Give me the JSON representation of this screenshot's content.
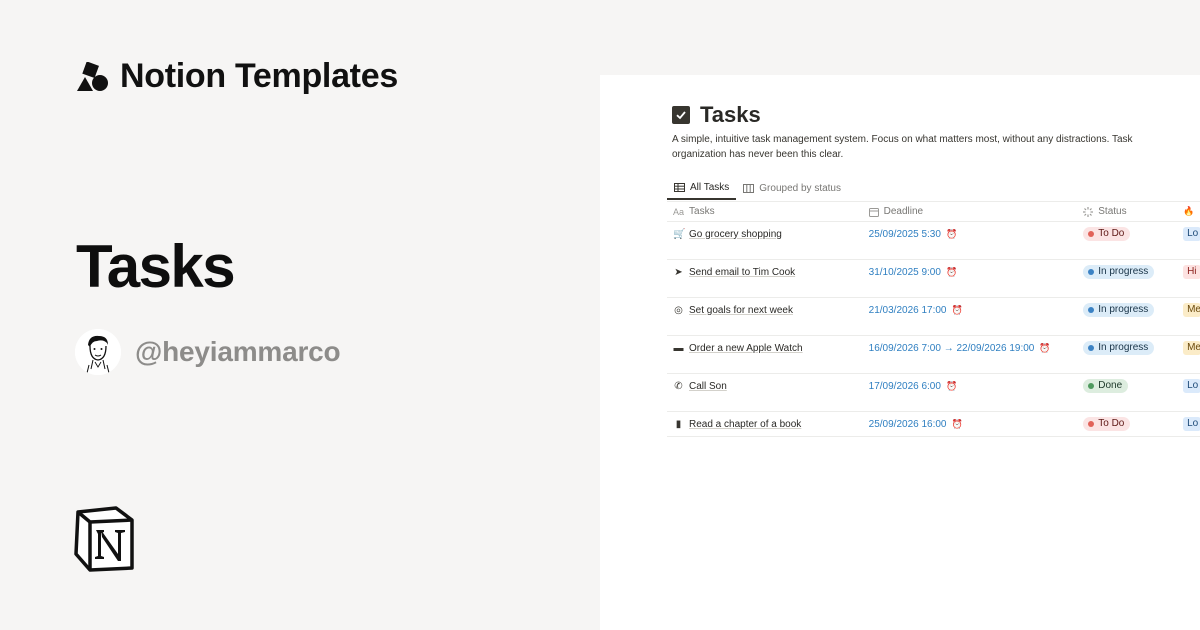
{
  "brand": {
    "name": "Notion Templates"
  },
  "hero": {
    "title": "Tasks",
    "handle": "@heyiammarco"
  },
  "preview": {
    "title": "Tasks",
    "description": "A simple, intuitive task management system. Focus on what matters most, without any distractions. Task organization has never been this clear.",
    "tabs": [
      {
        "label": "All Tasks",
        "icon": "table-icon",
        "active": true
      },
      {
        "label": "Grouped by status",
        "icon": "board-icon",
        "active": false
      }
    ],
    "columns": [
      {
        "label": "Tasks",
        "icon": "Aa"
      },
      {
        "label": "Deadline",
        "icon": "calendar-icon"
      },
      {
        "label": "Status",
        "icon": "status-icon"
      },
      {
        "label": "",
        "icon": "fire-icon"
      }
    ],
    "rows": [
      {
        "icon": "cart-icon",
        "glyph": "🛒",
        "task": "Go grocery shopping",
        "deadline": "25/09/2025 5:30",
        "status": "To Do",
        "status_color": "#fbe4e4",
        "dot_color": "#e16259",
        "text_color": "#5d1715",
        "prio": "Lo",
        "prio_bg": "#dbeafb",
        "prio_color": "#1d4a78"
      },
      {
        "icon": "paper-plane-icon",
        "glyph": "➤",
        "task": "Send email to Tim Cook",
        "deadline": "31/10/2025 9:00",
        "status": "In progress",
        "status_color": "#dcecf8",
        "dot_color": "#3b82c4",
        "text_color": "#183347",
        "prio": "Hi",
        "prio_bg": "#fde2e1",
        "prio_color": "#8a1f1b"
      },
      {
        "icon": "target-icon",
        "glyph": "◎",
        "task": "Set goals for next week",
        "deadline": "21/03/2026 17:00",
        "status": "In progress",
        "status_color": "#dcecf8",
        "dot_color": "#3b82c4",
        "text_color": "#183347",
        "prio": "Me",
        "prio_bg": "#fbecc8",
        "prio_color": "#6b4a0d"
      },
      {
        "icon": "laptop-icon",
        "glyph": "▬",
        "task": "Order a new Apple Watch",
        "deadline": "16/09/2026 7:00 → 22/09/2026 19:00",
        "status": "In progress",
        "status_color": "#dcecf8",
        "dot_color": "#3b82c4",
        "text_color": "#183347",
        "prio": "Me",
        "prio_bg": "#fbecc8",
        "prio_color": "#6b4a0d"
      },
      {
        "icon": "phone-icon",
        "glyph": "✆",
        "task": "Call Son",
        "deadline": "17/09/2026 6:00",
        "status": "Done",
        "status_color": "#ddeddf",
        "dot_color": "#4f9a5e",
        "text_color": "#1c3829",
        "prio": "Lo",
        "prio_bg": "#dbeafb",
        "prio_color": "#1d4a78"
      },
      {
        "icon": "book-icon",
        "glyph": "▮",
        "task": "Read a chapter of a book",
        "deadline": "25/09/2026 16:00",
        "status": "To Do",
        "status_color": "#fbe4e4",
        "dot_color": "#e16259",
        "text_color": "#5d1715",
        "prio": "Lo",
        "prio_bg": "#dbeafb",
        "prio_color": "#1d4a78"
      }
    ]
  },
  "colors": {
    "background": "#f6f5f4",
    "deadline": "#2f7fc1",
    "handle": "#8d8c8a"
  }
}
